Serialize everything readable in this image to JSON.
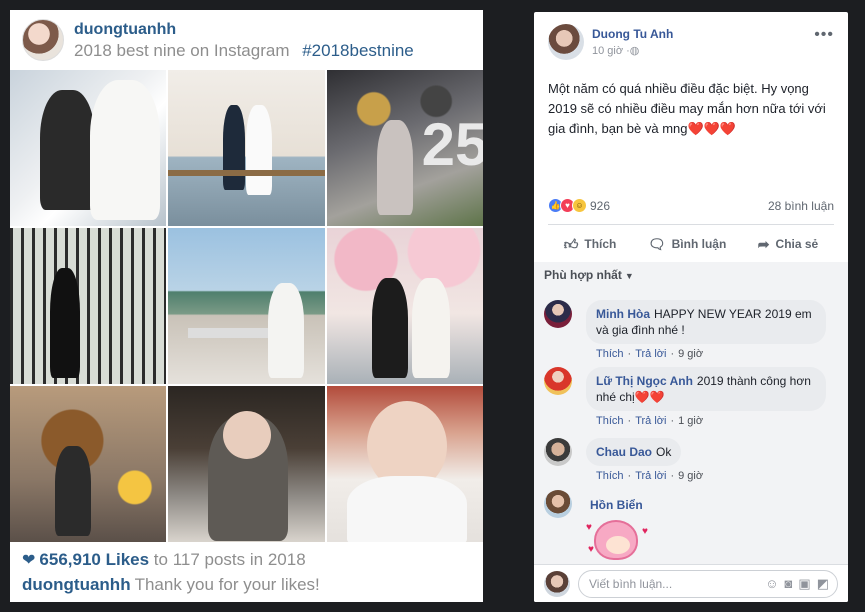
{
  "instagram": {
    "username": "duongtuanhh",
    "subtitle": "2018 best nine on Instagram",
    "hashtag": "#2018bestnine",
    "likes": "656,910 Likes",
    "likes_rest": "to 117 posts in 2018",
    "thanks_user": "duongtuanhh",
    "thanks_text": "Thank you for your likes!"
  },
  "post": {
    "author": "Duong Tu Anh",
    "time": "10 giờ",
    "privacy_icon": "globe-icon",
    "message": "Một năm có quá nhiều điều đặc biệt. Hy vọng 2019 sẽ có nhiều điều may mắn hơn nữa tới với gia đình, bạn bè và mng",
    "hearts": "❤️❤️❤️",
    "reaction_count": "926",
    "comment_count": "28 bình luận",
    "actions": {
      "like": "Thích",
      "comment": "Bình luận",
      "share": "Chia sẻ"
    },
    "sort_label": "Phù hợp nhất"
  },
  "comments": [
    {
      "name": "Minh Hòa",
      "text": "HAPPY NEW YEAR 2019 em và gia đình nhé !",
      "like": "Thích",
      "reply": "Trả lời",
      "time": "9 giờ"
    },
    {
      "name": "Lữ Thị Ngọc Anh",
      "text": "2019 thành công hơn nhé chị❤️❤️",
      "like": "Thích",
      "reply": "Trả lời",
      "time": "1 giờ"
    },
    {
      "name": "Chau Dao",
      "text": "Ok",
      "like": "Thích",
      "reply": "Trả lời",
      "time": "9 giờ"
    },
    {
      "name": "Hồn Biển",
      "text": "",
      "like": "",
      "reply": "",
      "time": ""
    }
  ],
  "composer": {
    "placeholder": "Viết bình luận..."
  },
  "colors": {
    "fb_link": "#385898",
    "insta_blue": "#2c5d8a",
    "heart": "#e0245e"
  }
}
